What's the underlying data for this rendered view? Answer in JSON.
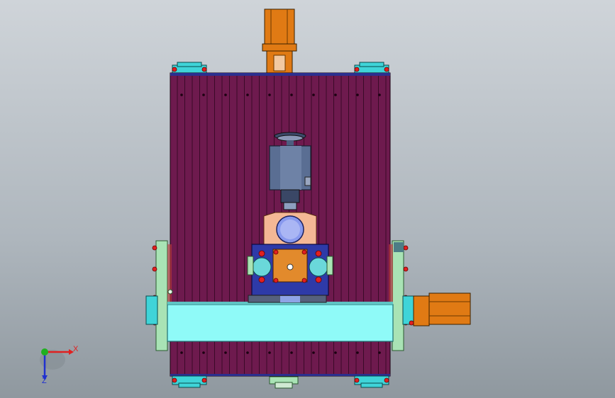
{
  "viewport": {
    "background_top": "#cfd4d9",
    "background_bottom": "#8f989f"
  },
  "colors": {
    "frame_body": "#6e1a4e",
    "frame_slat_line": "#3a0a28",
    "frame_top_edge": "#2b2f8f",
    "motor_orange": "#e07a14",
    "coupling_cyan": "#3fd4d8",
    "crossbeam_cyan": "#8ffaf8",
    "side_plate_green": "#a9e3b5",
    "spindle_steel": "#5a6e93",
    "saddle_peach": "#f4b895",
    "carriage_blue": "#2e3aa8",
    "carriage_block_orange": "#e28a2c",
    "bolt_red": "#e22020",
    "axis_x": "#e02020",
    "axis_y": "#20b020",
    "axis_z": "#2030d0"
  },
  "triad": {
    "x_label": "X",
    "z_label": "Z"
  }
}
